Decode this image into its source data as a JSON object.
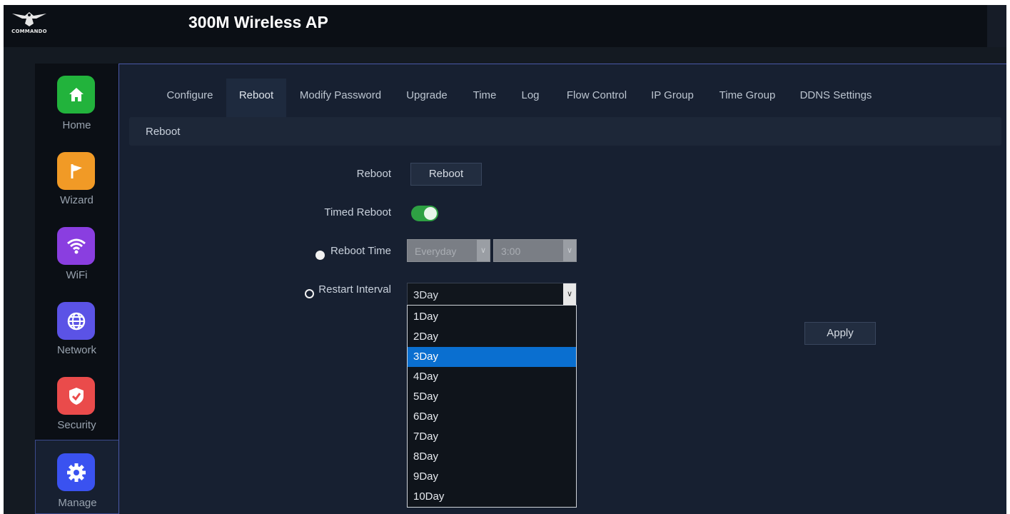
{
  "brand": {
    "logo_text": "COMMANDO"
  },
  "header": {
    "title": "300M Wireless AP"
  },
  "sidebar": {
    "items": [
      {
        "label": "Home",
        "icon": "home-icon",
        "color": "#22b33c"
      },
      {
        "label": "Wizard",
        "icon": "flag-icon",
        "color": "#f19a26"
      },
      {
        "label": "WiFi",
        "icon": "wifi-icon",
        "color": "#8a3ee0"
      },
      {
        "label": "Network",
        "icon": "globe-icon",
        "color": "#5b53e6"
      },
      {
        "label": "Security",
        "icon": "shield-icon",
        "color": "#ea4b4b"
      },
      {
        "label": "Manage",
        "icon": "gear-icon",
        "color": "#3a52f0",
        "active": true
      }
    ]
  },
  "tabs": [
    {
      "label": "Configure"
    },
    {
      "label": "Reboot",
      "active": true
    },
    {
      "label": "Modify Password"
    },
    {
      "label": "Upgrade"
    },
    {
      "label": "Time"
    },
    {
      "label": "Log"
    },
    {
      "label": "Flow Control"
    },
    {
      "label": "IP Group"
    },
    {
      "label": "Time Group"
    },
    {
      "label": "DDNS Settings"
    }
  ],
  "section": {
    "title": "Reboot"
  },
  "form": {
    "reboot_label": "Reboot",
    "reboot_button": "Reboot",
    "timed_reboot_label": "Timed Reboot",
    "timed_reboot_enabled": true,
    "reboot_time_label": "Reboot Time",
    "reboot_time_day": "Everyday",
    "reboot_time_hour": "3:00",
    "restart_interval_label": "Restart Interval",
    "restart_interval_value": "3Day",
    "restart_interval_options": [
      "1Day",
      "2Day",
      "3Day",
      "4Day",
      "5Day",
      "6Day",
      "7Day",
      "8Day",
      "9Day",
      "10Day"
    ],
    "apply_button": "Apply"
  },
  "colors": {
    "accent_tab_underline": "#c47a2c",
    "toggle_on": "#2ea043",
    "dropdown_selected": "#0a6fd0"
  }
}
